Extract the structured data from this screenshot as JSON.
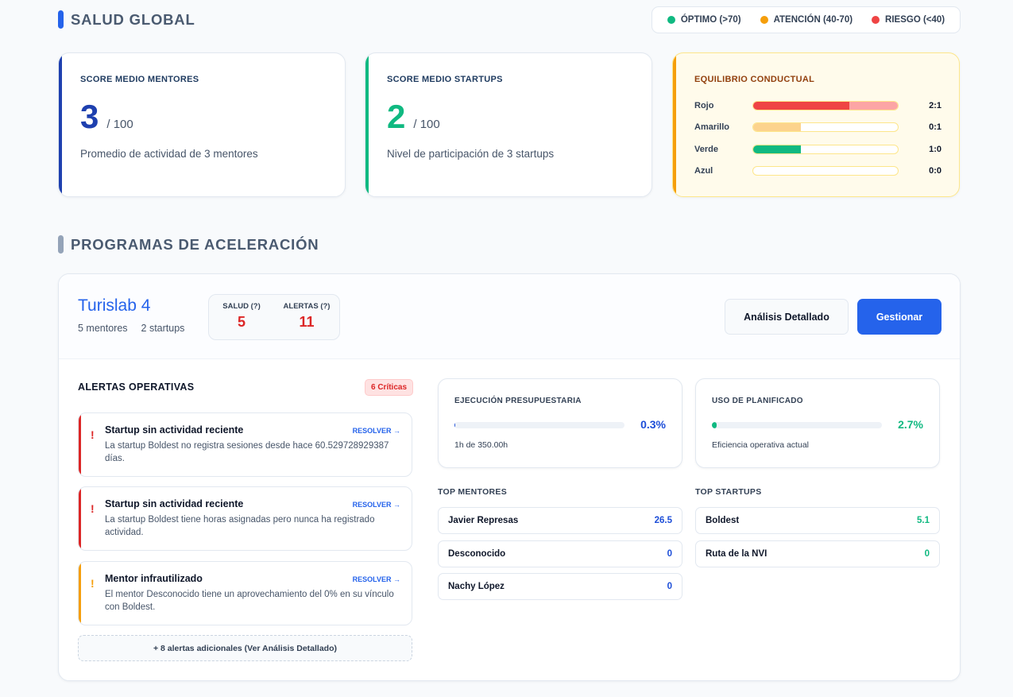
{
  "global": {
    "title": "SALUD GLOBAL",
    "legend": [
      {
        "label": "ÓPTIMO (>70)",
        "color": "#10b981"
      },
      {
        "label": "ATENCIÓN (40-70)",
        "color": "#f59e0b"
      },
      {
        "label": "RIESGO (<40)",
        "color": "#ef4444"
      }
    ],
    "mentors_score": {
      "label": "SCORE MEDIO MENTORES",
      "value": "3",
      "of": "/ 100",
      "desc": "Promedio de actividad de 3 mentores",
      "color": "#1e40af"
    },
    "startups_score": {
      "label": "SCORE MEDIO STARTUPS",
      "value": "2",
      "of": "/ 100",
      "desc": "Nivel de participación de 3 startups",
      "color": "#10b981"
    },
    "balance": {
      "label": "EQUILIBRIO CONDUCTUAL",
      "rows": [
        {
          "name": "Rojo",
          "ratio": "2:1",
          "primary": 0.667,
          "secondary": 0.333,
          "color": "#ef4444",
          "color2": "#fca5a5"
        },
        {
          "name": "Amarillo",
          "ratio": "0:1",
          "primary": 0.33,
          "secondary": 0,
          "color": "#fcd38d",
          "color2": "#fde68a"
        },
        {
          "name": "Verde",
          "ratio": "1:0",
          "primary": 0.33,
          "secondary": 0,
          "color": "#10b981",
          "color2": "#6ee7b7"
        },
        {
          "name": "Azul",
          "ratio": "0:0",
          "primary": 0,
          "secondary": 0,
          "color": "#3b82f6",
          "color2": "#93c5fd"
        }
      ]
    }
  },
  "programs": {
    "title": "PROGRAMAS DE ACELERACIÓN",
    "name": "Turislab 4",
    "mentors": "5 mentores",
    "startups": "2 startups",
    "health_label": "SALUD (?)",
    "health_value": "5",
    "alerts_label": "ALERTAS (?)",
    "alerts_value": "11",
    "detail_button": "Análisis Detallado",
    "manage_button": "Gestionar"
  },
  "alerts": {
    "title": "ALERTAS OPERATIVAS",
    "critical_badge": "6 Críticas",
    "resolve_label": "RESOLVER →",
    "items": [
      {
        "title": "Startup sin actividad reciente",
        "desc": "La startup Boldest no registra sesiones desde hace 60.529728929387 días.",
        "color": "#dc2626"
      },
      {
        "title": "Startup sin actividad reciente",
        "desc": "La startup Boldest tiene horas asignadas pero nunca ha registrado actividad.",
        "color": "#dc2626"
      },
      {
        "title": "Mentor infrautilizado",
        "desc": "El mentor Desconocido tiene un aprovechamiento del 0% en su vínculo con Boldest.",
        "color": "#f59e0b"
      }
    ],
    "more": "+ 8 alertas adicionales (Ver Análisis Detallado)"
  },
  "budget": {
    "title": "EJECUCIÓN PRESUPUESTARIA",
    "value": "0.3%",
    "fraction": 0.003,
    "sub": "1h de 350.00h",
    "color": "#1d4ed8"
  },
  "planned": {
    "title": "USO DE PLANIFICADO",
    "value": "2.7%",
    "fraction": 0.027,
    "sub": "Eficiencia operativa actual",
    "color": "#10b981"
  },
  "top_mentors": {
    "title": "TOP MENTORES",
    "items": [
      {
        "name": "Javier Represas",
        "value": "26.5"
      },
      {
        "name": "Desconocido",
        "value": "0"
      },
      {
        "name": "Nachy López",
        "value": "0"
      }
    ]
  },
  "top_startups": {
    "title": "TOP STARTUPS",
    "items": [
      {
        "name": "Boldest",
        "value": "5.1"
      },
      {
        "name": "Ruta de la NVI",
        "value": "0"
      }
    ]
  }
}
